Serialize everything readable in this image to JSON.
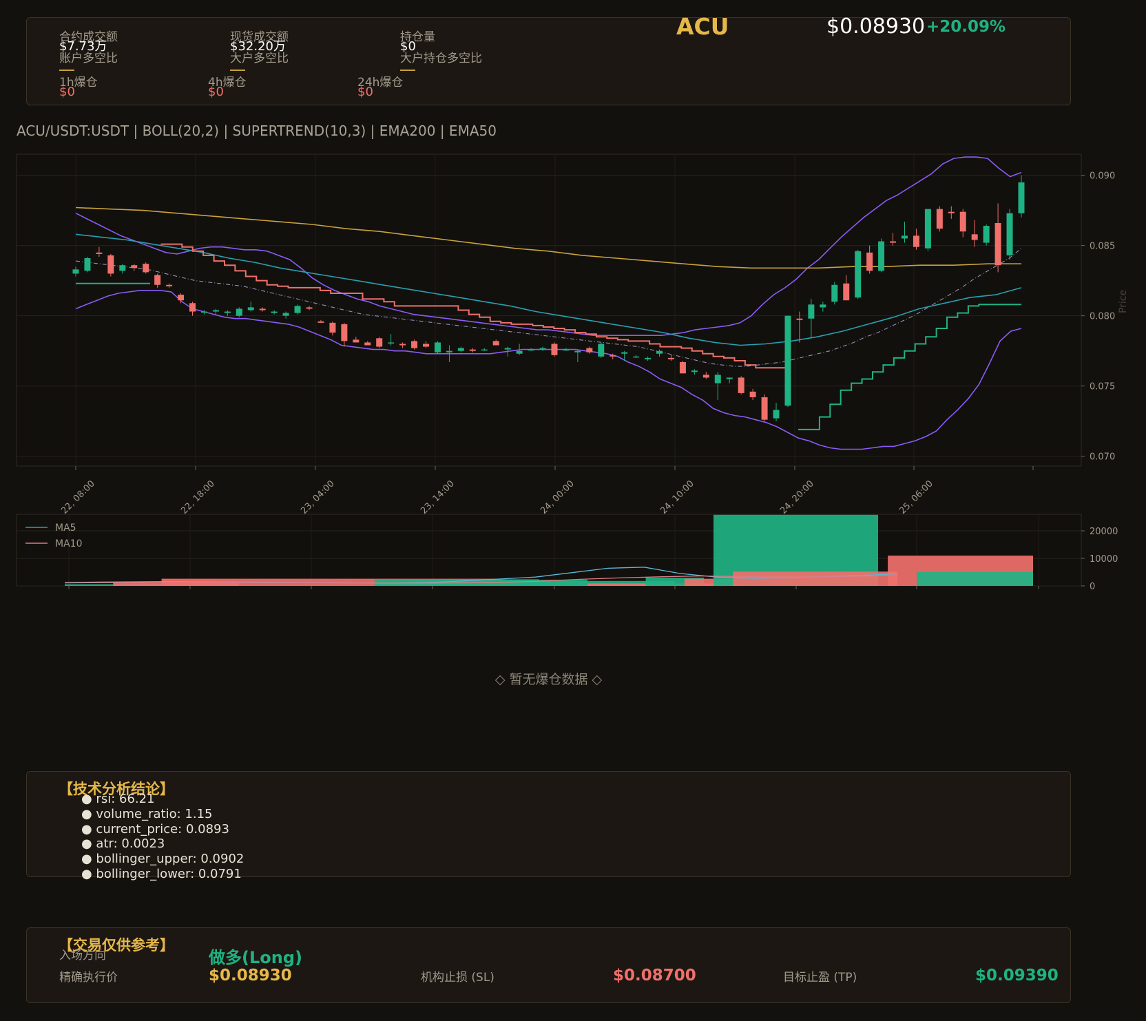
{
  "header": {
    "symbol": "ACU",
    "price": "$0.08930",
    "change": "+20.09%",
    "stats": [
      {
        "label": "合约成交额",
        "value": "$7.73万"
      },
      {
        "label": "现货成交额",
        "value": "$32.20万"
      },
      {
        "label": "持仓量",
        "value": "$0"
      }
    ],
    "ratios": [
      "账户多空比",
      "大户多空比",
      "大户持仓多空比"
    ],
    "liq": [
      {
        "label": "1h爆仓",
        "value": "$0"
      },
      {
        "label": "4h爆仓",
        "value": "$0"
      },
      {
        "label": "24h爆仓",
        "value": "$0"
      }
    ]
  },
  "chart_title": "ACU/USDT:USDT | BOLL(20,2) | SUPERTREND(10,3) | EMA200 | EMA50",
  "chart_data": [
    {
      "type": "candlestick",
      "title": "ACU/USDT:USDT | BOLL(20,2) | SUPERTREND(10,3) | EMA200 | EMA50",
      "ylabel": "Price",
      "ylim": [
        0.0693,
        0.0915
      ],
      "yticks": [
        "0.070",
        "0.075",
        "0.080",
        "0.085",
        "0.090"
      ],
      "xticks": [
        "Jun 22, 08:00",
        "Jun 22, 18:00",
        "Jun 23, 04:00",
        "Jun 23, 14:00",
        "Jun 24, 00:00",
        "Jun 24, 10:00",
        "Jun 24, 20:00",
        "Jun 25, 06:00"
      ],
      "xtick_labels_visible": [
        "un 22, 08:00",
        "un 22, 18:00",
        "un 23, 04:00",
        "un 23, 14:00",
        "un 24, 00:00",
        "un 24, 10:00",
        "un 24, 20:00",
        "un 25, 06:00"
      ],
      "candles": [
        [
          0.083,
          0.0835,
          0.0828,
          0.0833
        ],
        [
          0.0832,
          0.0842,
          0.0831,
          0.0841
        ],
        [
          0.0845,
          0.0849,
          0.0842,
          0.0844
        ],
        [
          0.0843,
          0.0844,
          0.0828,
          0.083
        ],
        [
          0.0832,
          0.0837,
          0.083,
          0.0836
        ],
        [
          0.0836,
          0.0837,
          0.0832,
          0.0834
        ],
        [
          0.0837,
          0.0838,
          0.083,
          0.0831
        ],
        [
          0.0829,
          0.083,
          0.082,
          0.0822
        ],
        [
          0.0822,
          0.0823,
          0.082,
          0.0821
        ],
        [
          0.0815,
          0.0816,
          0.0809,
          0.0811
        ],
        [
          0.0809,
          0.081,
          0.08,
          0.0803
        ],
        [
          0.0803,
          0.0804,
          0.0801,
          0.0803
        ],
        [
          0.0803,
          0.0805,
          0.0801,
          0.0804
        ],
        [
          0.0802,
          0.0804,
          0.08,
          0.0803
        ],
        [
          0.08,
          0.0806,
          0.0799,
          0.0805
        ],
        [
          0.0804,
          0.081,
          0.0803,
          0.0806
        ],
        [
          0.0805,
          0.0806,
          0.0803,
          0.0804
        ],
        [
          0.0802,
          0.0804,
          0.0801,
          0.0803
        ],
        [
          0.08,
          0.0803,
          0.0798,
          0.0802
        ],
        [
          0.0802,
          0.0808,
          0.0801,
          0.0807
        ],
        [
          0.0806,
          0.0807,
          0.0804,
          0.0805
        ],
        [
          0.0796,
          0.0797,
          0.0795,
          0.0795
        ],
        [
          0.0795,
          0.0796,
          0.0786,
          0.0788
        ],
        [
          0.0794,
          0.0795,
          0.0778,
          0.0782
        ],
        [
          0.0783,
          0.0785,
          0.0781,
          0.0781
        ],
        [
          0.0781,
          0.0782,
          0.0779,
          0.0779
        ],
        [
          0.0784,
          0.0785,
          0.0777,
          0.0778
        ],
        [
          0.0781,
          0.0787,
          0.0779,
          0.0781
        ],
        [
          0.078,
          0.0781,
          0.0777,
          0.0779
        ],
        [
          0.0782,
          0.0783,
          0.0776,
          0.0777
        ],
        [
          0.078,
          0.0782,
          0.0777,
          0.0778
        ],
        [
          0.0774,
          0.0782,
          0.0773,
          0.0781
        ],
        [
          0.0774,
          0.0779,
          0.0767,
          0.0775
        ],
        [
          0.0775,
          0.0778,
          0.0774,
          0.0777
        ],
        [
          0.0776,
          0.0777,
          0.0774,
          0.0775
        ],
        [
          0.0776,
          0.0777,
          0.0775,
          0.0776
        ],
        [
          0.0782,
          0.0783,
          0.0779,
          0.0779
        ],
        [
          0.0776,
          0.0778,
          0.0771,
          0.0777
        ],
        [
          0.0773,
          0.078,
          0.0772,
          0.0775
        ],
        [
          0.0776,
          0.0777,
          0.0775,
          0.0776
        ],
        [
          0.0776,
          0.0778,
          0.0775,
          0.0777
        ],
        [
          0.078,
          0.0781,
          0.0771,
          0.0772
        ],
        [
          0.0776,
          0.0777,
          0.0775,
          0.0776
        ],
        [
          0.0774,
          0.0776,
          0.0767,
          0.0775
        ],
        [
          0.0777,
          0.0778,
          0.0773,
          0.0774
        ],
        [
          0.0771,
          0.0781,
          0.077,
          0.078
        ],
        [
          0.0772,
          0.0773,
          0.0769,
          0.0771
        ],
        [
          0.0773,
          0.0775,
          0.0768,
          0.0774
        ],
        [
          0.0771,
          0.0772,
          0.077,
          0.0771
        ],
        [
          0.0769,
          0.0771,
          0.0768,
          0.077
        ],
        [
          0.0773,
          0.0776,
          0.0771,
          0.0775
        ],
        [
          0.077,
          0.0772,
          0.0768,
          0.0769
        ],
        [
          0.0767,
          0.0768,
          0.0759,
          0.0759
        ],
        [
          0.076,
          0.0762,
          0.0758,
          0.0761
        ],
        [
          0.0758,
          0.076,
          0.0755,
          0.0756
        ],
        [
          0.0752,
          0.076,
          0.074,
          0.0758
        ],
        [
          0.0755,
          0.0756,
          0.0752,
          0.0756
        ],
        [
          0.0756,
          0.0757,
          0.0744,
          0.0745
        ],
        [
          0.0746,
          0.0748,
          0.074,
          0.0742
        ],
        [
          0.0742,
          0.0744,
          0.0725,
          0.0726
        ],
        [
          0.0727,
          0.0738,
          0.0725,
          0.0733
        ],
        [
          0.0736,
          0.08,
          0.0735,
          0.08
        ],
        [
          0.0798,
          0.0803,
          0.0781,
          0.0797
        ],
        [
          0.0798,
          0.0812,
          0.0784,
          0.0808
        ],
        [
          0.0806,
          0.081,
          0.0803,
          0.0808
        ],
        [
          0.081,
          0.0824,
          0.0808,
          0.0822
        ],
        [
          0.0823,
          0.0829,
          0.0813,
          0.0811
        ],
        [
          0.0813,
          0.0847,
          0.0812,
          0.0846
        ],
        [
          0.0845,
          0.085,
          0.083,
          0.0832
        ],
        [
          0.0832,
          0.0855,
          0.0831,
          0.0853
        ],
        [
          0.0853,
          0.0859,
          0.085,
          0.0852
        ],
        [
          0.0855,
          0.0867,
          0.0852,
          0.0857
        ],
        [
          0.0857,
          0.0862,
          0.0847,
          0.0849
        ],
        [
          0.0848,
          0.0876,
          0.0846,
          0.0876
        ],
        [
          0.0876,
          0.0878,
          0.086,
          0.0862
        ],
        [
          0.0874,
          0.0878,
          0.0869,
          0.0873
        ],
        [
          0.0874,
          0.0876,
          0.0856,
          0.086
        ],
        [
          0.0858,
          0.0868,
          0.0849,
          0.0854
        ],
        [
          0.0852,
          0.0865,
          0.085,
          0.0864
        ],
        [
          0.0866,
          0.088,
          0.0831,
          0.0836
        ],
        [
          0.0843,
          0.0876,
          0.084,
          0.0873
        ],
        [
          0.0873,
          0.09,
          0.087,
          0.0895
        ]
      ],
      "bollinger_upper": [
        0.0873,
        0.0869,
        0.0865,
        0.0861,
        0.0857,
        0.0854,
        0.0851,
        0.0848,
        0.0845,
        0.0844,
        0.0846,
        0.0848,
        0.0849,
        0.0849,
        0.0848,
        0.0847,
        0.0847,
        0.0846,
        0.0843,
        0.084,
        0.0834,
        0.0827,
        0.0822,
        0.0818,
        0.0815,
        0.0812,
        0.081,
        0.0807,
        0.0805,
        0.0803,
        0.0801,
        0.08,
        0.0799,
        0.0798,
        0.0797,
        0.0796,
        0.0795,
        0.0794,
        0.0793,
        0.0792,
        0.0791,
        0.079,
        0.079,
        0.0789,
        0.0788,
        0.0787,
        0.0786,
        0.0786,
        0.0786,
        0.0786,
        0.0786,
        0.0786,
        0.0786,
        0.0787,
        0.0788,
        0.079,
        0.0791,
        0.0792,
        0.0793,
        0.0795,
        0.08,
        0.0808,
        0.0815,
        0.082,
        0.0826,
        0.0834,
        0.084,
        0.0848,
        0.0856,
        0.0863,
        0.087,
        0.0876,
        0.0882,
        0.0886,
        0.0891,
        0.0896,
        0.0901,
        0.0908,
        0.0912,
        0.0913,
        0.0913,
        0.0912,
        0.0905,
        0.0899,
        0.0902
      ],
      "bollinger_lower": [
        0.0805,
        0.0808,
        0.0811,
        0.0814,
        0.0816,
        0.0817,
        0.0818,
        0.0818,
        0.0818,
        0.0817,
        0.081,
        0.0805,
        0.0803,
        0.0801,
        0.0799,
        0.0798,
        0.0798,
        0.0797,
        0.0796,
        0.0795,
        0.0794,
        0.0792,
        0.0789,
        0.0786,
        0.0783,
        0.0779,
        0.0778,
        0.0777,
        0.0776,
        0.0776,
        0.0775,
        0.0775,
        0.0774,
        0.0773,
        0.0773,
        0.0773,
        0.0773,
        0.0773,
        0.0773,
        0.0773,
        0.0774,
        0.0775,
        0.0776,
        0.0776,
        0.0776,
        0.0776,
        0.0776,
        0.0776,
        0.0775,
        0.0774,
        0.0773,
        0.0771,
        0.0767,
        0.0764,
        0.076,
        0.0755,
        0.0752,
        0.0749,
        0.0744,
        0.074,
        0.0734,
        0.0731,
        0.0729,
        0.0728,
        0.0726,
        0.0724,
        0.0721,
        0.0717,
        0.0713,
        0.0711,
        0.0708,
        0.0706,
        0.0705,
        0.0705,
        0.0705,
        0.0706,
        0.0707,
        0.0707,
        0.0709,
        0.0711,
        0.0714,
        0.0718,
        0.0726,
        0.0733,
        0.0741,
        0.0751,
        0.0766,
        0.0782,
        0.0789,
        0.0791
      ],
      "bollinger_mid": [
        0.0839,
        0.0838,
        0.0837,
        0.0836,
        0.0835,
        0.0834,
        0.0833,
        0.0831,
        0.0829,
        0.0827,
        0.0825,
        0.0824,
        0.0823,
        0.0822,
        0.0821,
        0.0819,
        0.0817,
        0.0815,
        0.0813,
        0.0811,
        0.0809,
        0.0807,
        0.0805,
        0.0803,
        0.0801,
        0.08,
        0.0799,
        0.0798,
        0.0797,
        0.0796,
        0.0795,
        0.0794,
        0.0793,
        0.0792,
        0.0791,
        0.079,
        0.0789,
        0.0788,
        0.0787,
        0.0786,
        0.0785,
        0.0784,
        0.0783,
        0.0782,
        0.0781,
        0.078,
        0.0779,
        0.0778,
        0.0776,
        0.0774,
        0.0772,
        0.077,
        0.0768,
        0.0766,
        0.0765,
        0.0764,
        0.0764,
        0.0765,
        0.0766,
        0.0767,
        0.0769,
        0.0771,
        0.0773,
        0.0775,
        0.0778,
        0.0781,
        0.0785,
        0.0788,
        0.0792,
        0.0796,
        0.08,
        0.0805,
        0.081,
        0.0815,
        0.082,
        0.0826,
        0.0831,
        0.0836,
        0.0841,
        0.0848
      ],
      "supertrend": [
        0.0823,
        0.0823,
        0.0823,
        0.0823,
        0.0823,
        0.0823,
        0.0823,
        0.0823,
        0.0851,
        0.0851,
        0.0849,
        0.0846,
        0.0843,
        0.0839,
        0.0836,
        0.0832,
        0.0828,
        0.0825,
        0.0822,
        0.0821,
        0.082,
        0.082,
        0.082,
        0.0818,
        0.0816,
        0.0816,
        0.0816,
        0.0812,
        0.0812,
        0.081,
        0.0807,
        0.0807,
        0.0807,
        0.0807,
        0.0807,
        0.0807,
        0.0804,
        0.0801,
        0.0799,
        0.0796,
        0.0795,
        0.0794,
        0.0794,
        0.0793,
        0.0792,
        0.0791,
        0.079,
        0.0788,
        0.0787,
        0.0785,
        0.0784,
        0.0783,
        0.0782,
        0.0782,
        0.078,
        0.0778,
        0.0778,
        0.0777,
        0.0775,
        0.0773,
        0.0771,
        0.077,
        0.0768,
        0.0765,
        0.0763,
        0.0763,
        0.0763,
        0.0763,
        0.0719,
        0.0719,
        0.0728,
        0.0737,
        0.0747,
        0.0752,
        0.0755,
        0.076,
        0.0765,
        0.077,
        0.0775,
        0.078,
        0.0785,
        0.0791,
        0.0799,
        0.0802,
        0.0807,
        0.0808,
        0.0808,
        0.0808,
        0.0808,
        0.0808
      ],
      "supertrend_direction": "bearish then bullish from Jun 24 ~19:00",
      "ema200": [
        0.0877,
        0.0876,
        0.0875,
        0.0873,
        0.0871,
        0.0869,
        0.0867,
        0.0865,
        0.0862,
        0.086,
        0.0857,
        0.0854,
        0.0851,
        0.0848,
        0.0846,
        0.0843,
        0.0841,
        0.0839,
        0.0837,
        0.0835,
        0.0834,
        0.0834,
        0.0834,
        0.0835,
        0.0835,
        0.0836,
        0.0836,
        0.0837,
        0.0837
      ],
      "ema50": [
        0.0858,
        0.0856,
        0.0854,
        0.0851,
        0.0848,
        0.0845,
        0.0841,
        0.0838,
        0.0834,
        0.0831,
        0.0828,
        0.0825,
        0.0822,
        0.0819,
        0.0816,
        0.0813,
        0.081,
        0.0807,
        0.0803,
        0.08,
        0.0797,
        0.0794,
        0.0791,
        0.0788,
        0.0784,
        0.0781,
        0.0779,
        0.078,
        0.0782,
        0.0785,
        0.0789,
        0.0794,
        0.0799,
        0.0805,
        0.0809,
        0.0813,
        0.0815,
        0.082
      ]
    },
    {
      "type": "bar",
      "title": "",
      "legend": [
        "MA5",
        "MA10"
      ],
      "legend_position": "top-left",
      "ylim": [
        0,
        26000
      ],
      "yticks": [
        "0",
        "10000",
        "20000"
      ],
      "volume_blocks": [
        {
          "x_from": 0.0,
          "x_to": 0.1,
          "value": 600,
          "dir": "up"
        },
        {
          "x_from": 0.05,
          "x_to": 0.18,
          "value": 1200,
          "dir": "down"
        },
        {
          "x_from": 0.1,
          "x_to": 0.45,
          "value": 2600,
          "dir": "down"
        },
        {
          "x_from": 0.32,
          "x_to": 0.49,
          "value": 2400,
          "dir": "up"
        },
        {
          "x_from": 0.38,
          "x_to": 0.54,
          "value": 2200,
          "dir": "up"
        },
        {
          "x_from": 0.45,
          "x_to": 0.63,
          "value": 1800,
          "dir": "up"
        },
        {
          "x_from": 0.54,
          "x_to": 0.7,
          "value": 900,
          "dir": "down"
        },
        {
          "x_from": 0.6,
          "x_to": 0.66,
          "value": 3000,
          "dir": "up"
        },
        {
          "x_from": 0.64,
          "x_to": 0.69,
          "value": 2600,
          "dir": "down"
        },
        {
          "x_from": 0.67,
          "x_to": 0.84,
          "value": 25800,
          "dir": "up"
        },
        {
          "x_from": 0.69,
          "x_to": 0.86,
          "value": 5200,
          "dir": "down"
        },
        {
          "x_from": 0.85,
          "x_to": 1.0,
          "value": 11000,
          "dir": "down"
        },
        {
          "x_from": 0.88,
          "x_to": 1.0,
          "value": 5000,
          "dir": "up"
        }
      ],
      "ma5": [
        1200,
        1400,
        1500,
        1600,
        1500,
        1400,
        1300,
        1200,
        1100,
        1000,
        1200,
        1800,
        2500,
        3200,
        4800,
        6400,
        6800,
        4500,
        3200,
        2800,
        3000,
        3400,
        3800,
        4400
      ],
      "ma10": [
        1100,
        1200,
        1300,
        1400,
        1300,
        1200,
        1200,
        1100,
        1000,
        1000,
        1100,
        1300,
        1700,
        2400,
        2900,
        3300,
        3600,
        3400,
        3200,
        3300,
        3500,
        3800
      ]
    }
  ],
  "liquidation_empty": "◇ 暂无爆仓数据 ◇",
  "analysis": {
    "title": "【技术分析结论】",
    "items": [
      "● rsi: 66.21",
      "● volume_ratio: 1.15",
      "● current_price: 0.0893",
      "● atr: 0.0023",
      "● bollinger_upper: 0.0902",
      "● bollinger_lower: 0.0791"
    ]
  },
  "trade": {
    "title": "【交易仅供参考】",
    "direction_label": "入场方向",
    "direction_value": "做多(Long)",
    "entry_label": "精确执行价",
    "entry_value": "$0.08930",
    "sl_label": "机构止损 (SL)",
    "sl_value": "$0.08700",
    "tp_label": "目标止盈 (TP)",
    "tp_value": "$0.09390"
  },
  "colors": {
    "up": "#1fb283",
    "down": "#f0706b",
    "boll": "#8b5cf6",
    "ema200": "#c9a23a",
    "ema50": "#2a9fb0",
    "supertrend_bear": "#f0706b",
    "supertrend_bull": "#1fb283",
    "gold": "#e6b84a",
    "background": "#13110e",
    "panel": "#1c1712"
  }
}
